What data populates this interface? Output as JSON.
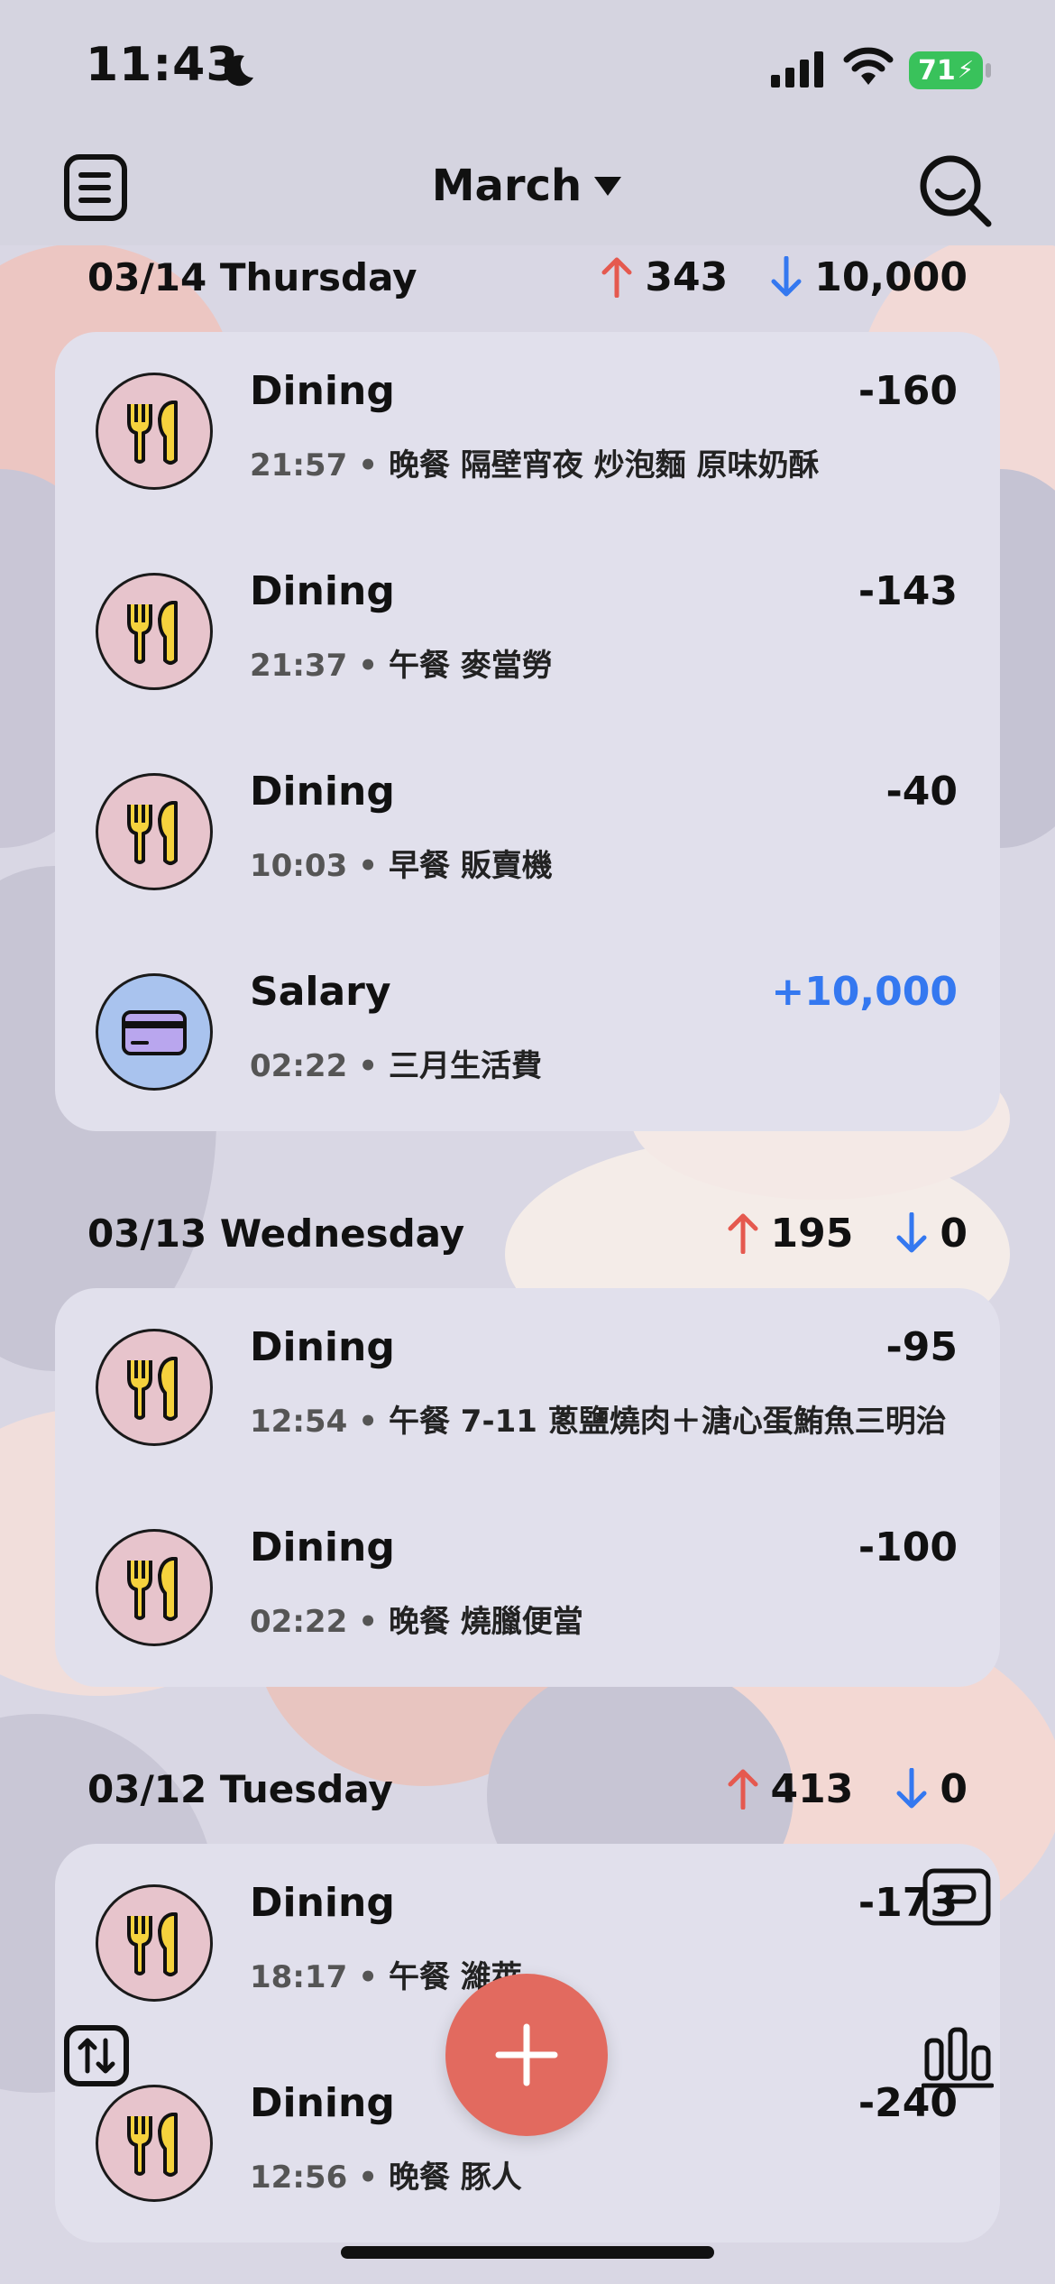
{
  "status_bar": {
    "time": "11:43",
    "battery": "71"
  },
  "header": {
    "month": "March"
  },
  "days": [
    {
      "label": "03/14 Thursday",
      "expense_total": "343",
      "income_total": "10,000",
      "transactions": [
        {
          "category": "Dining",
          "time": "21:57",
          "note": "晚餐 隔壁宵夜 炒泡麵 原味奶酥",
          "amount": "-160",
          "icon": "fork-knife-icon"
        },
        {
          "category": "Dining",
          "time": "21:37",
          "note": "午餐 麥當勞",
          "amount": "-143",
          "icon": "fork-knife-icon"
        },
        {
          "category": "Dining",
          "time": "10:03",
          "note": "早餐 販賣機",
          "amount": "-40",
          "icon": "fork-knife-icon"
        },
        {
          "category": "Salary",
          "time": "02:22",
          "note": "三月生活費",
          "amount": "+10,000",
          "icon": "credit-card-icon"
        }
      ]
    },
    {
      "label": "03/13 Wednesday",
      "expense_total": "195",
      "income_total": "0",
      "transactions": [
        {
          "category": "Dining",
          "time": "12:54",
          "note": "午餐 7-11 蔥鹽燒肉＋溏心蛋鮪魚三明治",
          "amount": "-95",
          "icon": "fork-knife-icon"
        },
        {
          "category": "Dining",
          "time": "02:22",
          "note": "晚餐 燒臘便當",
          "amount": "-100",
          "icon": "fork-knife-icon"
        }
      ]
    },
    {
      "label": "03/12 Tuesday",
      "expense_total": "413",
      "income_total": "0",
      "transactions": [
        {
          "category": "Dining",
          "time": "18:17",
          "note": "午餐 濰萊",
          "amount": "-173",
          "icon": "fork-knife-icon"
        },
        {
          "category": "Dining",
          "time": "12:56",
          "note": "晚餐 豚人",
          "amount": "-240",
          "icon": "fork-knife-icon"
        }
      ]
    }
  ],
  "colors": {
    "expense_arrow": "#e5594f",
    "income_arrow": "#3478f0",
    "income_amount": "#3478f0",
    "fab": "#e26a5f"
  }
}
